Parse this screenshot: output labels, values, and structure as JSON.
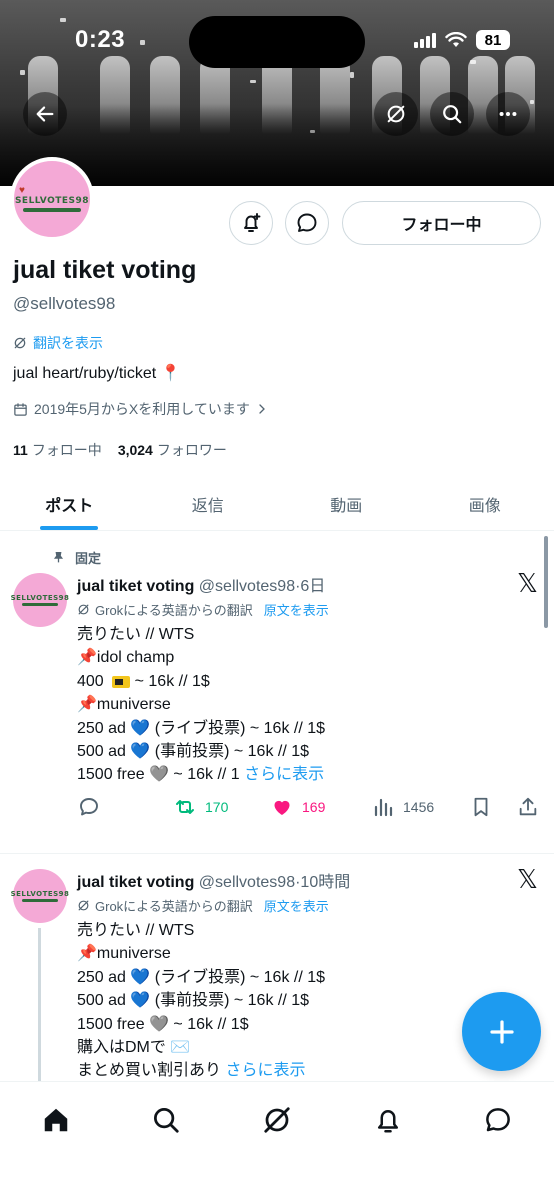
{
  "status_bar": {
    "time": "0:23",
    "battery": "81"
  },
  "profile": {
    "avatar_text": "SELLVOTES98",
    "name": "jual tiket voting",
    "handle": "@sellvotes98",
    "translate_label": "翻訳を表示",
    "bio": "jual heart/ruby/ticket 📍",
    "joined": "2019年5月からXを利用しています",
    "following_count": "11",
    "following_label": "フォロー中",
    "followers_count": "3,024",
    "followers_label": "フォロワー",
    "follow_button": "フォロー中"
  },
  "tabs": [
    {
      "label": "ポスト",
      "active": true
    },
    {
      "label": "返信",
      "active": false
    },
    {
      "label": "動画",
      "active": false
    },
    {
      "label": "画像",
      "active": false
    }
  ],
  "posts": [
    {
      "pinned_label": "固定",
      "author": "jual tiket voting",
      "handle": "@sellvotes98",
      "time": "6日",
      "translation_note": "Grokによる英語からの翻訳",
      "show_original": "原文を表示",
      "lines": [
        "売りたい // WTS",
        "📌idol champ",
        "400",
        "~ 16k // 1$",
        "📌muniverse",
        "250 ad 💙 (ライブ投票) ~ 16k // 1$",
        "500 ad 💙 (事前投票) ~ 16k // 1$",
        "1500 free 🩶 ~ 16k // 1"
      ],
      "show_more": "さらに表示",
      "stats": {
        "retweets": "170",
        "likes": "169",
        "views": "1456"
      }
    },
    {
      "author": "jual tiket voting",
      "handle": "@sellvotes98",
      "time": "10時間",
      "translation_note": "Grokによる英語からの翻訳",
      "show_original": "原文を表示",
      "lines": [
        "売りたい // WTS",
        "📌muniverse",
        "250 ad 💙 (ライブ投票) ~ 16k // 1$",
        "500 ad 💙 (事前投票) ~ 16k // 1$",
        "1500 free 🩶 ~ 16k // 1$",
        "購入はDMで ✉️",
        "まとめ買い割引あり"
      ],
      "show_more": "さらに表示"
    }
  ],
  "colors": {
    "accent": "#1d9bf0",
    "retweet": "#00ba7c",
    "like": "#f91880",
    "avatar_bg": "#f4a9d6"
  }
}
